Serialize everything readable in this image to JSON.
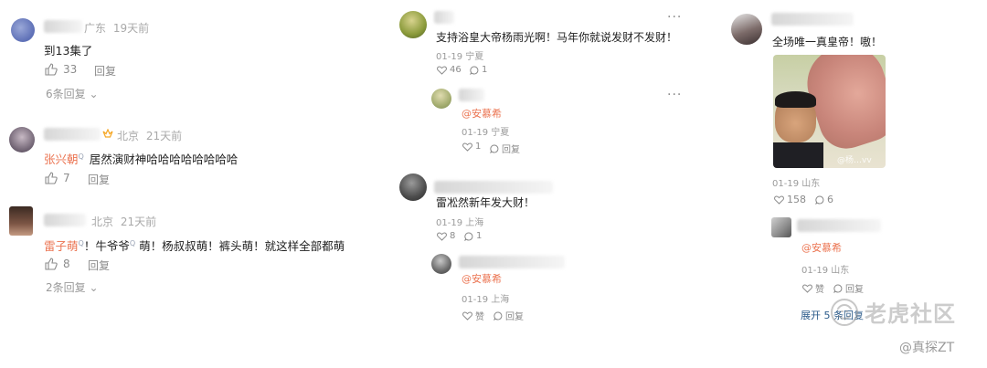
{
  "col1": {
    "c1": {
      "location": "广东",
      "time": "19天前",
      "text": "到13集了",
      "likes": "33",
      "reply": "回复",
      "more": "6条回复"
    },
    "c2": {
      "location": "北京",
      "time": "21天前",
      "link_name": "张兴朝",
      "text": "居然演财神哈哈哈哈哈哈哈哈",
      "likes": "7",
      "reply": "回复"
    },
    "c3": {
      "location": "北京",
      "time": "21天前",
      "link1": "雷子萌",
      "mid1": "！牛爷爷",
      "mid2": "萌！杨叔叔萌！裤头萌！就这样全部都萌",
      "likes": "8",
      "reply": "回复",
      "more": "2条回复"
    }
  },
  "col2": {
    "c1": {
      "text": "支持浴皇大帝杨雨光啊！马年你就说发财不发财！",
      "meta": "01-19 宁夏",
      "likes": "46",
      "comments": "1"
    },
    "r1": {
      "mention": "@安慕希",
      "meta": "01-19 宁夏",
      "likes": "1",
      "reply": "回复"
    },
    "c2": {
      "text": "雷凇然新年发大财！",
      "meta": "01-19 上海",
      "likes": "8",
      "comments": "1"
    },
    "r2": {
      "mention": "@安慕希",
      "meta": "01-19 上海",
      "likes": "赞",
      "reply": "回复"
    }
  },
  "col3": {
    "c1": {
      "text": "全场唯一真皇帝！嗷！",
      "photo_watermark": "@杨…vv",
      "meta": "01-19 山东",
      "likes": "158",
      "comments": "6"
    },
    "r1": {
      "mention": "@安慕希",
      "meta": "01-19 山东",
      "likes": "赞",
      "reply": "回复",
      "expand": "展开 5 条回复"
    }
  },
  "watermarks": {
    "main": "老虎社区",
    "handle": "@真探ZT"
  },
  "colors": {
    "link": "#eb7350",
    "vip": "#f5a623",
    "meta": "#a9a9a9"
  }
}
